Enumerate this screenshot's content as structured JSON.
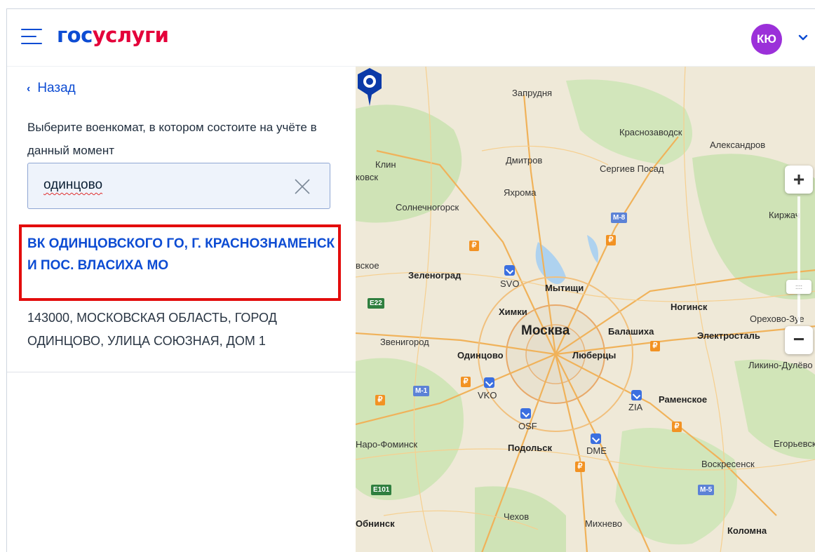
{
  "header": {
    "logo_part1": "гос",
    "logo_part2": "услуги",
    "avatar_initials": "КЮ"
  },
  "left_panel": {
    "back_label": "Назад",
    "prompt": "Выберите военкомат, в котором состоите на учёте в данный момент",
    "search_value": "одинцово",
    "result_title": "ВК ОДИНЦОВСКОГО ГО, Г. КРАСНОЗНАМЕНСК И ПОС. ВЛАСИХА МО",
    "result_address": "143000, МОСКОВСКАЯ ОБЛАСТЬ, ГОРОД ОДИНЦОВО, УЛИЦА СОЮЗНАЯ, ДОМ 1"
  },
  "map": {
    "places": {
      "zapрudnya": "Запрудня",
      "krasnozavodsk": "Краснозаводск",
      "aleksandrov": "Александров",
      "klin": "Клин",
      "dmitrov": "Дмитров",
      "sergiev_posad": "Сергиев Посад",
      "kovsk": "ковск",
      "yakhroma": "Яхрома",
      "solnechnogorsk": "Солнечногорск",
      "kirzhach": "Киржач",
      "vskoe": "вское",
      "zelenograd": "Зеленоград",
      "svo": "SVO",
      "mytishchi": "Мытищи",
      "khimki": "Химки",
      "noginsk": "Ногинск",
      "orekhovo": "Орехово-Зуе",
      "moskva": "Москва",
      "balashikha": "Балашиха",
      "elektrostal": "Электросталь",
      "zvenigorod": "Звенигород",
      "odintsovo": "Одинцово",
      "lyubertsy": "Люберцы",
      "likino": "Ликино-Дулёво",
      "vko": "VKO",
      "ramenskoe": "Раменское",
      "zia": "ZIA",
      "osf": "OSF",
      "naro_fominsk": "Наро-Фоминск",
      "podolsk": "Подольск",
      "dme": "DME",
      "egorevsk": "Егорьевск",
      "voskresensk": "Воскресенск",
      "chekhov": "Чехов",
      "obninsk": "Обнинск",
      "mikhnevo": "Михнево",
      "kolomna": "Коломна"
    },
    "roads": {
      "m8": "M-8",
      "e22": "E22",
      "m1": "M-1",
      "e101": "E101",
      "m5": "M-5"
    },
    "zoom_in": "+",
    "zoom_out": "−"
  },
  "colors": {
    "brand_blue": "#0d4cd3",
    "brand_red": "#e4003a",
    "avatar": "#9b30d9",
    "highlight": "#e30d0d"
  }
}
